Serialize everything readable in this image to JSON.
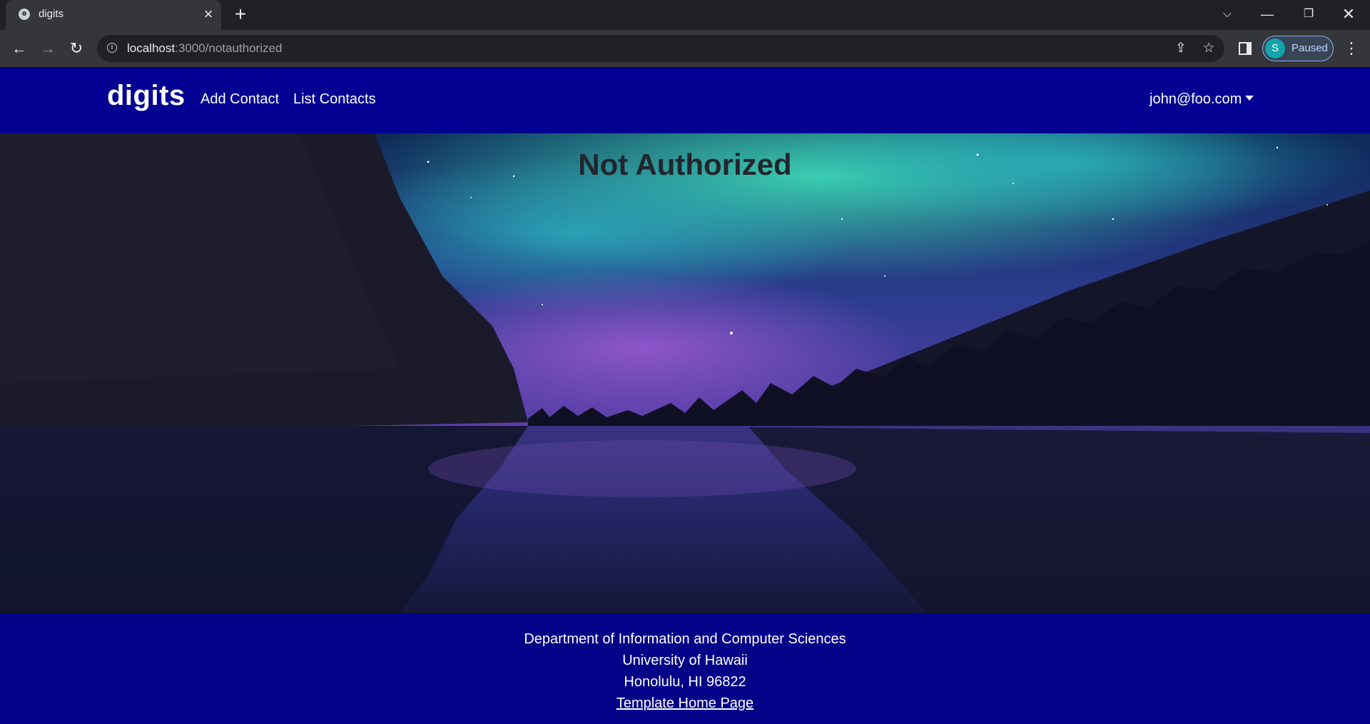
{
  "browser": {
    "tab_title": "digits",
    "url_host": "localhost",
    "url_rest": ":3000/notauthorized",
    "profile_initial": "S",
    "profile_status": "Paused"
  },
  "navbar": {
    "brand": "digits",
    "links": [
      "Add Contact",
      "List Contacts"
    ],
    "user": "john@foo.com"
  },
  "main": {
    "title": "Not Authorized"
  },
  "footer": {
    "lines": [
      "Department of Information and Computer Sciences",
      "University of Hawaii",
      "Honolulu, HI 96822"
    ],
    "link": "Template Home Page"
  },
  "colors": {
    "navbar": "#020192",
    "footer": "#020188",
    "browser_frame": "#202124"
  }
}
